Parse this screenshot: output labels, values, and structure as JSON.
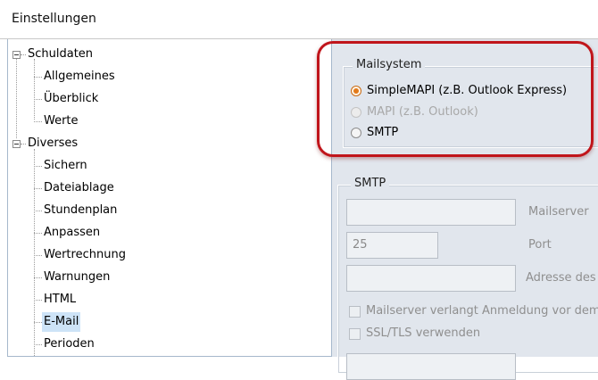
{
  "window": {
    "title": "Einstellungen"
  },
  "tree": {
    "schuldaten": {
      "label": "Schuldaten",
      "children": [
        "Allgemeines",
        "Überblick",
        "Werte"
      ]
    },
    "diverses": {
      "label": "Diverses",
      "children": [
        "Sichern",
        "Dateiablage",
        "Stundenplan",
        "Anpassen",
        "Wertrechnung",
        "Warnungen",
        "HTML",
        "E-Mail",
        "Perioden"
      ]
    },
    "selected": "E-Mail"
  },
  "mailsystem": {
    "legend": "Mailsystem",
    "options": [
      {
        "label": "SimpleMAPI (z.B. Outlook Express)",
        "checked": true,
        "enabled": true
      },
      {
        "label": "MAPI (z.B. Outlook)",
        "checked": false,
        "enabled": false
      },
      {
        "label": "SMTP",
        "checked": false,
        "enabled": true
      }
    ]
  },
  "smtp": {
    "legend": "SMTP",
    "mailserver_label": "Mailserver",
    "mailserver_value": "",
    "port_label": "Port",
    "port_value": "25",
    "adresse_label": "Adresse des",
    "adresse_value": "",
    "auth_label": "Mailserver verlangt Anmeldung vor dem",
    "ssl_label": "SSL/TLS verwenden"
  },
  "colors": {
    "accent_radio": "#e27a1a",
    "highlight": "#c0151b",
    "selection": "#cde3f7",
    "panel_bg": "#e1e6ed"
  }
}
